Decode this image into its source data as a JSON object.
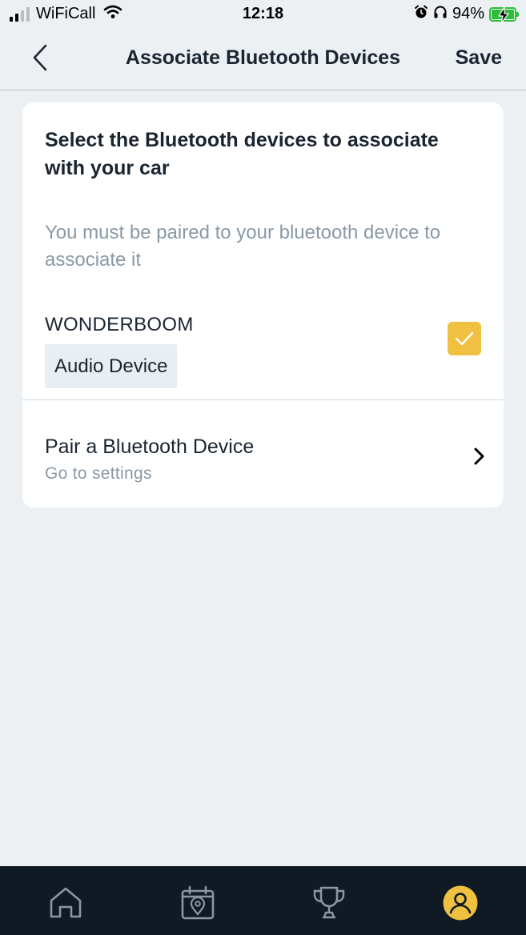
{
  "status_bar": {
    "carrier": "WiFiCall",
    "time": "12:18",
    "battery_percent": "94%",
    "icons": [
      "signal-icon",
      "wifi-icon",
      "alarm-icon",
      "headphones-icon",
      "battery-charging-icon"
    ]
  },
  "nav": {
    "back_icon": "chevron-left-icon",
    "title": "Associate Bluetooth Devices",
    "save_label": "Save"
  },
  "card": {
    "heading": "Select the Bluetooth devices to associate with your car",
    "note": "You must be paired to your bluetooth device to associate it",
    "device": {
      "name": "WONDERBOOM",
      "type": "Audio Device",
      "checked": true
    },
    "pair": {
      "title": "Pair a Bluetooth Device",
      "subtitle": "Go to settings",
      "icon": "chevron-right-icon"
    }
  },
  "tab_bar": {
    "tabs": [
      {
        "icon": "home-icon",
        "active": false
      },
      {
        "icon": "calendar-location-icon",
        "active": false
      },
      {
        "icon": "trophy-icon",
        "active": false
      },
      {
        "icon": "profile-icon",
        "active": true
      }
    ]
  },
  "colors": {
    "background": "#ecf0f3",
    "card": "#ffffff",
    "text": "#1b2530",
    "muted_text": "#8a99a6",
    "accent_yellow": "#f0c040",
    "tab_bar": "#101a24",
    "battery_green": "#2ebd3a"
  }
}
